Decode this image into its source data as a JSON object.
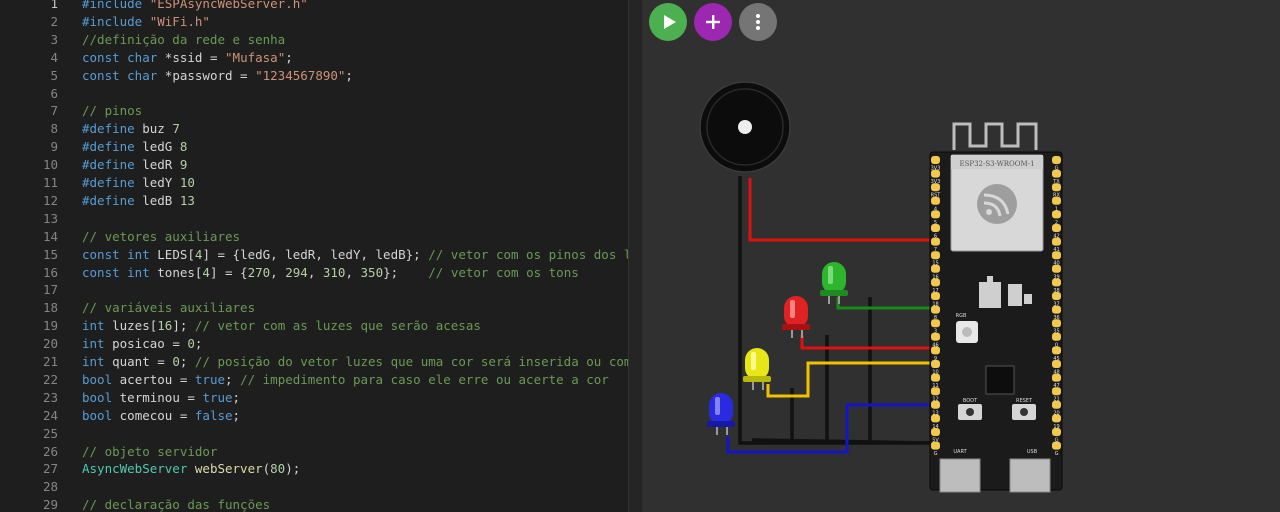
{
  "editor": {
    "lines": [
      {
        "n": "1",
        "t": [
          [
            "pp",
            "#include "
          ],
          [
            "str",
            "\"ESPAsyncWebServer.h\""
          ]
        ]
      },
      {
        "n": "2",
        "t": [
          [
            "pp",
            "#include "
          ],
          [
            "str",
            "\"WiFi.h\""
          ]
        ]
      },
      {
        "n": "3",
        "t": [
          [
            "cm",
            "//definição da rede e senha"
          ]
        ]
      },
      {
        "n": "4",
        "t": [
          [
            "kw",
            "const "
          ],
          [
            "kw",
            "char "
          ],
          [
            "",
            "*ssid = "
          ],
          [
            "str",
            "\"Mufasa\""
          ],
          [
            "",
            ";"
          ]
        ]
      },
      {
        "n": "5",
        "t": [
          [
            "kw",
            "const "
          ],
          [
            "kw",
            "char "
          ],
          [
            "",
            "*password = "
          ],
          [
            "str",
            "\"1234567890\""
          ],
          [
            "",
            ";"
          ]
        ]
      },
      {
        "n": "6",
        "t": []
      },
      {
        "n": "7",
        "t": [
          [
            "cm",
            "// pinos"
          ]
        ]
      },
      {
        "n": "8",
        "t": [
          [
            "pp",
            "#define "
          ],
          [
            "",
            "buz "
          ],
          [
            "num",
            "7"
          ]
        ]
      },
      {
        "n": "9",
        "t": [
          [
            "pp",
            "#define "
          ],
          [
            "",
            "ledG "
          ],
          [
            "num",
            "8"
          ]
        ]
      },
      {
        "n": "10",
        "t": [
          [
            "pp",
            "#define "
          ],
          [
            "",
            "ledR "
          ],
          [
            "num",
            "9"
          ]
        ]
      },
      {
        "n": "11",
        "t": [
          [
            "pp",
            "#define "
          ],
          [
            "",
            "ledY "
          ],
          [
            "num",
            "10"
          ]
        ]
      },
      {
        "n": "12",
        "t": [
          [
            "pp",
            "#define "
          ],
          [
            "",
            "ledB "
          ],
          [
            "num",
            "13"
          ]
        ]
      },
      {
        "n": "13",
        "t": []
      },
      {
        "n": "14",
        "t": [
          [
            "cm",
            "// vetores auxiliares"
          ]
        ]
      },
      {
        "n": "15",
        "t": [
          [
            "kw",
            "const "
          ],
          [
            "kw",
            "int "
          ],
          [
            "",
            "LEDS["
          ],
          [
            "num",
            "4"
          ],
          [
            "",
            "] = {ledG, ledR, ledY, ledB}; "
          ],
          [
            "cm",
            "// vetor com os pinos dos leds"
          ]
        ]
      },
      {
        "n": "16",
        "t": [
          [
            "kw",
            "const "
          ],
          [
            "kw",
            "int "
          ],
          [
            "",
            "tones["
          ],
          [
            "num",
            "4"
          ],
          [
            "",
            "] = {"
          ],
          [
            "num",
            "270"
          ],
          [
            "",
            ", "
          ],
          [
            "num",
            "294"
          ],
          [
            "",
            ", "
          ],
          [
            "num",
            "310"
          ],
          [
            "",
            ", "
          ],
          [
            "num",
            "350"
          ],
          [
            "",
            "};    "
          ],
          [
            "cm",
            "// vetor com os tons"
          ]
        ]
      },
      {
        "n": "17",
        "t": []
      },
      {
        "n": "18",
        "t": [
          [
            "cm",
            "// variáveis auxiliares"
          ]
        ]
      },
      {
        "n": "19",
        "t": [
          [
            "kw",
            "int "
          ],
          [
            "",
            "luzes["
          ],
          [
            "num",
            "16"
          ],
          [
            "",
            "]; "
          ],
          [
            "cm",
            "// vetor com as luzes que serão acesas"
          ]
        ]
      },
      {
        "n": "20",
        "t": [
          [
            "kw",
            "int "
          ],
          [
            "",
            "posicao = "
          ],
          [
            "num",
            "0"
          ],
          [
            "",
            ";"
          ]
        ]
      },
      {
        "n": "21",
        "t": [
          [
            "kw",
            "int "
          ],
          [
            "",
            "quant = "
          ],
          [
            "num",
            "0"
          ],
          [
            "",
            "; "
          ],
          [
            "cm",
            "// posição do vetor luzes que uma cor será inserida ou comparada"
          ]
        ]
      },
      {
        "n": "22",
        "t": [
          [
            "kw",
            "bool "
          ],
          [
            "",
            "acertou = "
          ],
          [
            "kw",
            "true"
          ],
          [
            "",
            "; "
          ],
          [
            "cm",
            "// impedimento para caso ele erre ou acerte a cor"
          ]
        ]
      },
      {
        "n": "23",
        "t": [
          [
            "kw",
            "bool "
          ],
          [
            "",
            "terminou = "
          ],
          [
            "kw",
            "true"
          ],
          [
            "",
            ";"
          ]
        ]
      },
      {
        "n": "24",
        "t": [
          [
            "kw",
            "bool "
          ],
          [
            "",
            "comecou = "
          ],
          [
            "kw",
            "false"
          ],
          [
            "",
            ";"
          ]
        ]
      },
      {
        "n": "25",
        "t": []
      },
      {
        "n": "26",
        "t": [
          [
            "cm",
            "// objeto servidor"
          ]
        ]
      },
      {
        "n": "27",
        "t": [
          [
            "ty",
            "AsyncWebServer "
          ],
          [
            "fn",
            "webServer"
          ],
          [
            "",
            "("
          ],
          [
            "num",
            "80"
          ],
          [
            "",
            ");"
          ]
        ]
      },
      {
        "n": "28",
        "t": []
      },
      {
        "n": "29",
        "t": [
          [
            "cm",
            "// declaração das funções"
          ]
        ]
      }
    ]
  },
  "toolbar": {
    "play": "play-icon",
    "add": "plus-icon",
    "more": "more-vert-icon"
  },
  "board": {
    "module_label": "ESP32-S3-WROOM-1",
    "left_pins": [
      "3V3",
      "3V3",
      "RST",
      "4",
      "5",
      "6",
      "7",
      "15",
      "16",
      "17",
      "18",
      "8",
      "3",
      "46",
      "9",
      "10",
      "11",
      "12",
      "13",
      "14",
      "5V",
      "G"
    ],
    "right_pins": [
      "G",
      "TX",
      "RX",
      "1",
      "2",
      "42",
      "41",
      "40",
      "39",
      "38",
      "37",
      "36",
      "35",
      "0",
      "45",
      "48",
      "47",
      "21",
      "20",
      "19",
      "G",
      "G"
    ],
    "rgb_label": "RGB",
    "boot_label": "BOOT",
    "reset_label": "RESET",
    "uart_label": "UART",
    "usb_label": "USB"
  },
  "colors": {
    "play": "#4caf50",
    "add": "#9c27b0",
    "more": "#757575",
    "wire_red": "#e01010",
    "wire_green": "#1a8a1a",
    "wire_yellow": "#f2c200",
    "wire_blue": "#1414c8",
    "wire_black": "#111111"
  }
}
